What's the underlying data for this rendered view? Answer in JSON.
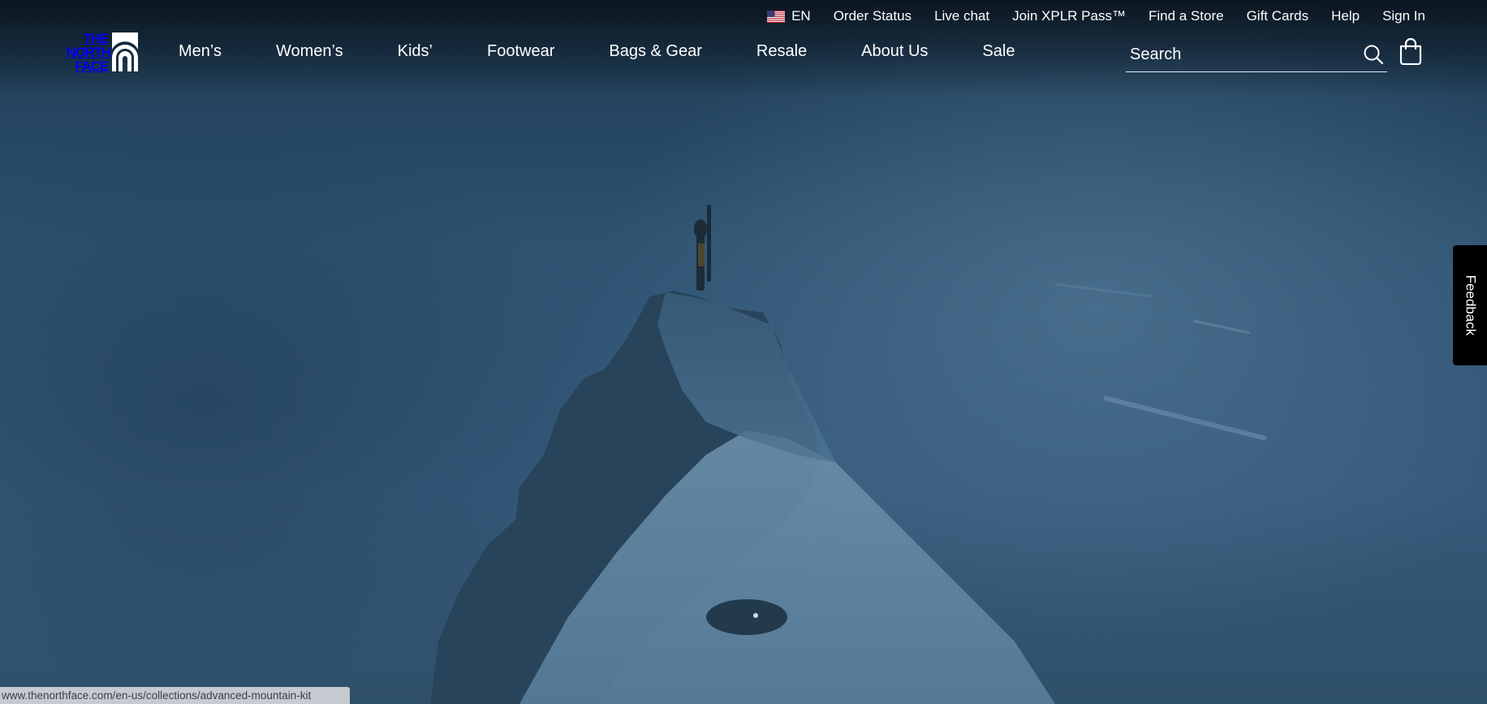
{
  "utility": {
    "language": "EN",
    "links": [
      "Order Status",
      "Live chat",
      "Join XPLR Pass™",
      "Find a Store",
      "Gift Cards",
      "Help",
      "Sign In"
    ]
  },
  "logo": {
    "lines": [
      "THE",
      "NORTH",
      "FACE"
    ]
  },
  "nav": {
    "mens": "Men’s",
    "womens": "Women’s",
    "kids": "Kids’",
    "footwear": "Footwear",
    "bags": "Bags & Gear",
    "resale": "Resale",
    "about": "About Us",
    "sale": "Sale"
  },
  "search": {
    "placeholder": "Search"
  },
  "icons": {
    "search": "search-icon",
    "bag": "shopping-bag-icon",
    "flag": "us-flag-icon"
  },
  "feedback": {
    "label": "Feedback"
  },
  "status_url": "www.thenorthface.com/en-us/collections/advanced-mountain-kit"
}
